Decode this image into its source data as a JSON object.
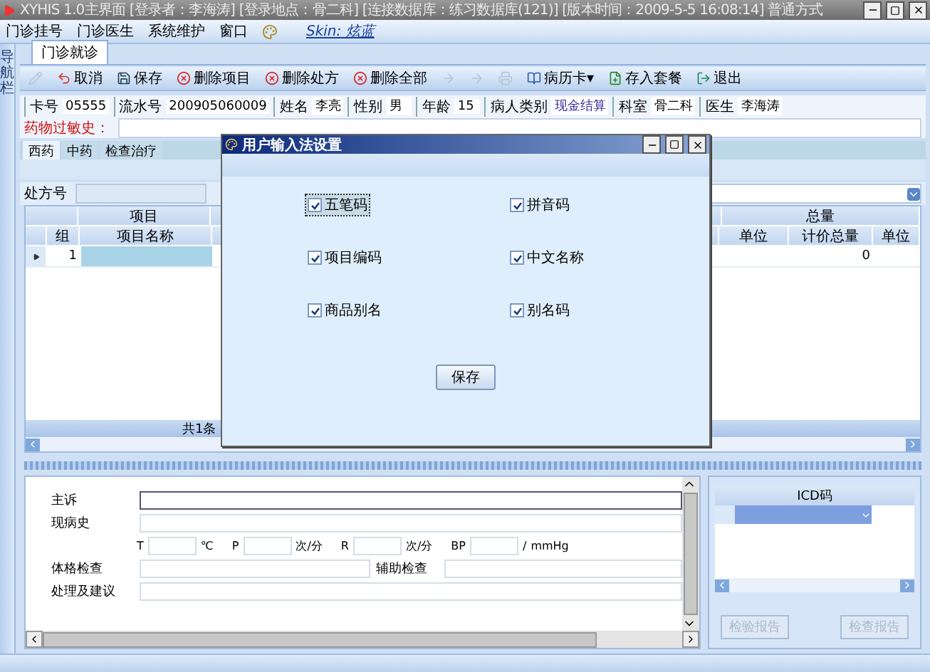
{
  "window": {
    "title": "XYHIS 1.0主界面  [登录者：李海涛]  [登录地点：骨二科]  [连接数据库：练习数据库(121)]  [版本时间：2009-5-5 16:08:14]  普通方式"
  },
  "menu": [
    "门诊挂号",
    "门诊医生",
    "系统维护",
    "窗口"
  ],
  "skin": "Skin: 炫蓝",
  "side_panel": {
    "label": "导航栏"
  },
  "doc_tabs": [
    {
      "label": "门诊就诊",
      "selected": true
    }
  ],
  "toolbar": [
    {
      "kind": "pencil",
      "disabled": true
    },
    {
      "kind": "undo",
      "label": "取消",
      "disabled": false
    },
    {
      "kind": "save",
      "label": "保存",
      "disabled": false
    },
    {
      "kind": "delete",
      "label": "删除项目",
      "disabled": false
    },
    {
      "kind": "delete",
      "label": "删除处方",
      "disabled": false
    },
    {
      "kind": "delete",
      "label": "删除全部",
      "disabled": false
    },
    {
      "kind": "arrow",
      "disabled": true
    },
    {
      "kind": "arrow",
      "disabled": true
    },
    {
      "kind": "print",
      "disabled": true
    },
    {
      "kind": "card",
      "label": "病历卡▾",
      "disabled": false
    },
    {
      "kind": "package",
      "label": "存入套餐",
      "disabled": false
    },
    {
      "kind": "exit",
      "label": "退出",
      "disabled": false
    }
  ],
  "patient": [
    {
      "label": "卡号",
      "value": "05555",
      "highlight": false
    },
    {
      "label": "流水号",
      "value": "200905060009",
      "highlight": false
    },
    {
      "label": "姓名",
      "value": "李亮",
      "highlight": false
    },
    {
      "label": "性别",
      "value": "男",
      "highlight": false
    },
    {
      "label": "年龄",
      "value": "15",
      "highlight": false
    },
    {
      "label": "病人类别",
      "value": "现金结算",
      "highlight": true
    },
    {
      "label": "科室",
      "value": "骨二科",
      "highlight": false
    },
    {
      "label": "医生",
      "value": "李海涛",
      "highlight": false
    }
  ],
  "allergy": {
    "label": "药物过敏史："
  },
  "sub_tabs": [
    {
      "label": "西药",
      "selected": true
    },
    {
      "label": "中药",
      "selected": false
    },
    {
      "label": "检查治疗",
      "selected": false
    }
  ],
  "prescription": {
    "label": "处方号"
  },
  "grid": {
    "left_group": "项目",
    "right_group": "总量",
    "columns": [
      "组",
      "项目名称",
      "单位",
      "计价总量",
      "单位"
    ],
    "rows": [
      {
        "group": "1",
        "priced_total": "0",
        "selected": true
      }
    ],
    "footer": "共1条"
  },
  "dialog": {
    "title": "用户输入法设置",
    "options": [
      {
        "label": "五笔码",
        "checked": true,
        "focused": true
      },
      {
        "label": "拼音码",
        "checked": true,
        "focused": false
      },
      {
        "label": "项目编码",
        "checked": true,
        "focused": false
      },
      {
        "label": "中文名称",
        "checked": true,
        "focused": false
      },
      {
        "label": "商品别名",
        "checked": true,
        "focused": false
      },
      {
        "label": "别名码",
        "checked": true,
        "focused": false
      }
    ],
    "button": "保存"
  },
  "record": {
    "chief_complaint": {
      "label": "主诉",
      "focused": true
    },
    "history": {
      "label": "现病史"
    },
    "vitals": [
      {
        "label": "T",
        "unit": "℃"
      },
      {
        "label": "P",
        "unit": "次/分"
      },
      {
        "label": "R",
        "unit": "次/分"
      },
      {
        "label": "BP",
        "unit": "/"
      },
      {
        "unit": "mmHg"
      }
    ],
    "exam": {
      "label": "体格检查"
    },
    "aux_exam": {
      "label": "辅助检查"
    },
    "plan": {
      "label": "处理及建议"
    }
  },
  "icd": {
    "header": "ICD码",
    "buttons": [
      {
        "label": "检验报告",
        "disabled": true
      },
      {
        "label": "检查报告",
        "disabled": true
      }
    ]
  }
}
